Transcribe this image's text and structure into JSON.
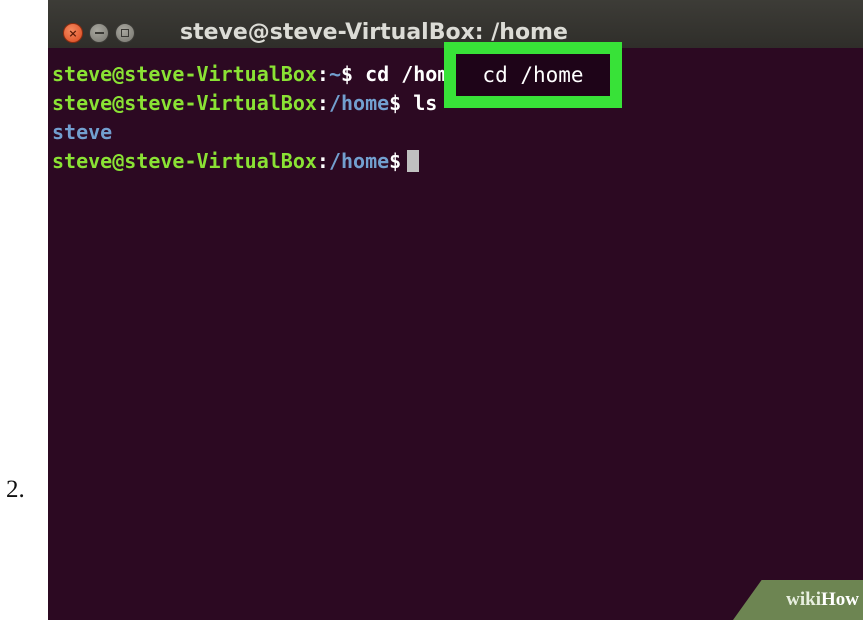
{
  "step": {
    "number": "2."
  },
  "window": {
    "title": "steve@steve-VirtualBox: /home",
    "close_glyph": "×"
  },
  "terminal": {
    "lines": [
      {
        "user": "steve@steve-VirtualBox",
        "colon": ":",
        "path": "~",
        "dollar": "$",
        "command": "cd /home"
      },
      {
        "user": "steve@steve-VirtualBox",
        "colon": ":",
        "path": "/home",
        "dollar": "$",
        "command": "ls"
      },
      {
        "output": "steve"
      },
      {
        "user": "steve@steve-VirtualBox",
        "colon": ":",
        "path": "/home",
        "dollar": "$",
        "command": ""
      }
    ]
  },
  "highlight": {
    "text": "cd /home",
    "color": "#38e238"
  },
  "watermark": {
    "prefix": "wiki",
    "suffix": "How"
  },
  "colors": {
    "terminal_bg": "#2c0922",
    "prompt_user": "#8ae234",
    "prompt_path": "#729fcf",
    "titlebar": "#3d3c37"
  }
}
